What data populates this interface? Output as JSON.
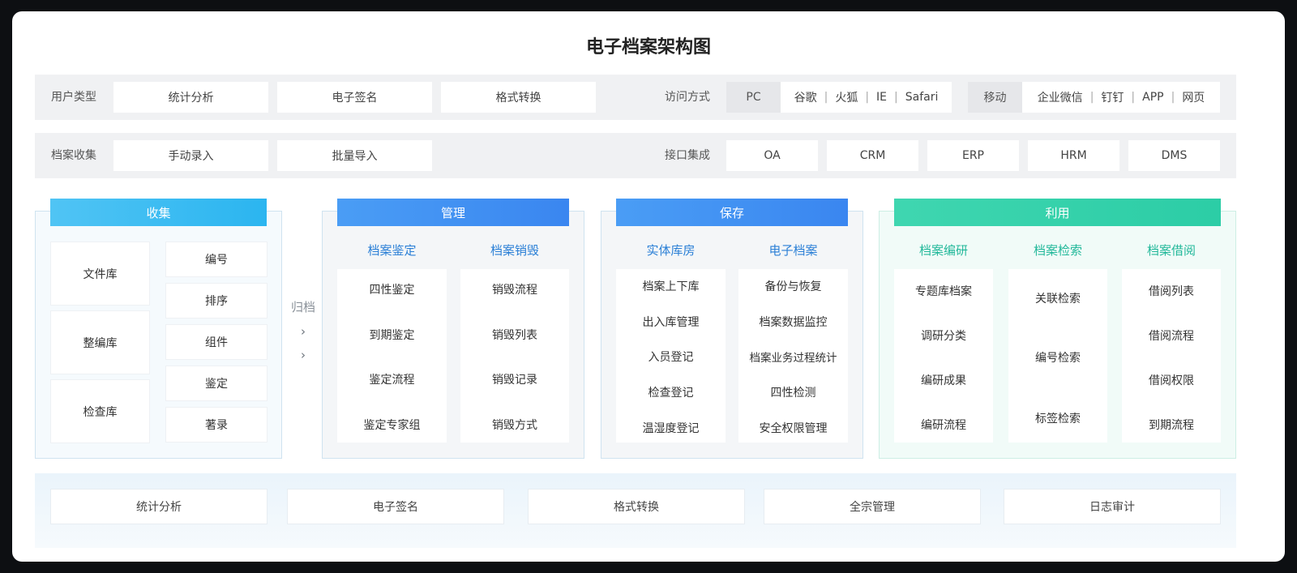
{
  "title": "电子档案架构图",
  "row1": {
    "label": "用户类型",
    "items": [
      "统计分析",
      "电子签名",
      "格式转换"
    ],
    "access_label": "访问方式",
    "pc_label": "PC",
    "pc_options": [
      "谷歌",
      "火狐",
      "IE",
      "Safari"
    ],
    "mobile_label": "移动",
    "mobile_options": [
      "企业微信",
      "钉钉",
      "APP",
      "网页"
    ]
  },
  "row2": {
    "label": "档案收集",
    "items": [
      "手动录入",
      "批量导入"
    ],
    "interface_label": "接口集成",
    "interfaces": [
      "OA",
      "CRM",
      "ERP",
      "HRM",
      "DMS"
    ]
  },
  "collect": {
    "header": "收集",
    "libraries": [
      "文件库",
      "整编库",
      "检查库"
    ],
    "ops": [
      "编号",
      "排序",
      "组件",
      "鉴定",
      "著录"
    ]
  },
  "archive": {
    "label": "归档",
    "chevrons": [
      "›",
      "›"
    ]
  },
  "manage": {
    "header": "管理",
    "columns": [
      {
        "title": "档案鉴定",
        "items": [
          "四性鉴定",
          "到期鉴定",
          "鉴定流程",
          "鉴定专家组"
        ]
      },
      {
        "title": "档案销毁",
        "items": [
          "销毁流程",
          "销毁列表",
          "销毁记录",
          "销毁方式"
        ]
      }
    ]
  },
  "preserve": {
    "header": "保存",
    "columns": [
      {
        "title": "实体库房",
        "items": [
          "档案上下库",
          "出入库管理",
          "入员登记",
          "检查登记",
          "温湿度登记"
        ]
      },
      {
        "title": "电子档案",
        "items": [
          "备份与恢复",
          "档案数据监控",
          "档案业务过程统计",
          "四性检测",
          "安全权限管理"
        ]
      }
    ]
  },
  "utilize": {
    "header": "利用",
    "columns": [
      {
        "title": "档案编研",
        "items": [
          "专题库档案",
          "调研分类",
          "编研成果",
          "编研流程"
        ]
      },
      {
        "title": "档案检索",
        "items": [
          "关联检索",
          "编号检索",
          "标签检索"
        ]
      },
      {
        "title": "档案借阅",
        "items": [
          "借阅列表",
          "借阅流程",
          "借阅权限",
          "到期流程"
        ]
      }
    ]
  },
  "bottom": [
    "统计分析",
    "电子签名",
    "格式转换",
    "全宗管理",
    "日志审计"
  ],
  "colors": {
    "blue_header": "#3a86f0",
    "cyan_header": "#2bb5f0",
    "green_header": "#2ccda6",
    "blue_text": "#2a7fd6",
    "green_text": "#22b89a"
  }
}
